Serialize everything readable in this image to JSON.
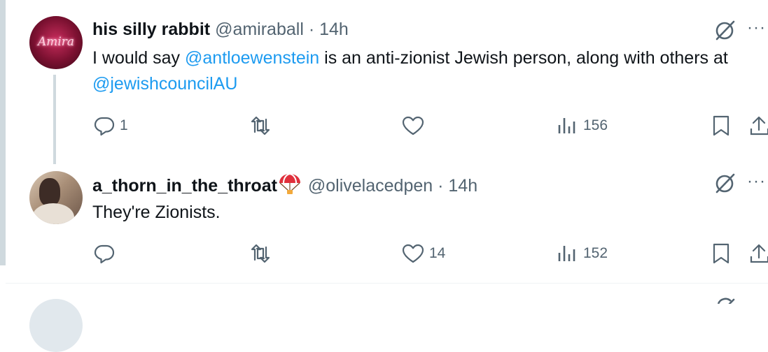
{
  "posts": [
    {
      "author_name": "his silly rabbit",
      "handle": "@amiraball",
      "separator": "·",
      "time": "14h",
      "avatar_text": "Amira",
      "text_segments": [
        {
          "text": "I would say ",
          "type": "text"
        },
        {
          "text": "@antloewenstein",
          "type": "mention"
        },
        {
          "text": " is an anti-zionist Jewish person, along with others at ",
          "type": "text"
        },
        {
          "text": "@jewishcouncilAU",
          "type": "mention"
        }
      ],
      "reply_count": "1",
      "retweet_count": "",
      "like_count": "",
      "view_count": "156"
    },
    {
      "author_name": "a_thorn_in_the_throat",
      "author_emoji": "parachute-icon",
      "handle": "@olivelacedpen",
      "separator": "·",
      "time": "14h",
      "text": "They're Zionists.",
      "reply_count": "",
      "retweet_count": "",
      "like_count": "14",
      "view_count": "152"
    }
  ],
  "icons": {
    "grok": "grok-icon",
    "more": "more-options-icon",
    "reply": "reply-icon",
    "retweet": "retweet-icon",
    "like": "like-icon",
    "views": "views-icon",
    "bookmark": "bookmark-icon",
    "share": "share-icon"
  },
  "colors": {
    "text": "#0f1419",
    "secondary": "#536471",
    "mention": "#1d9bf0",
    "border": "#cfd9de"
  },
  "more_glyph": "···"
}
